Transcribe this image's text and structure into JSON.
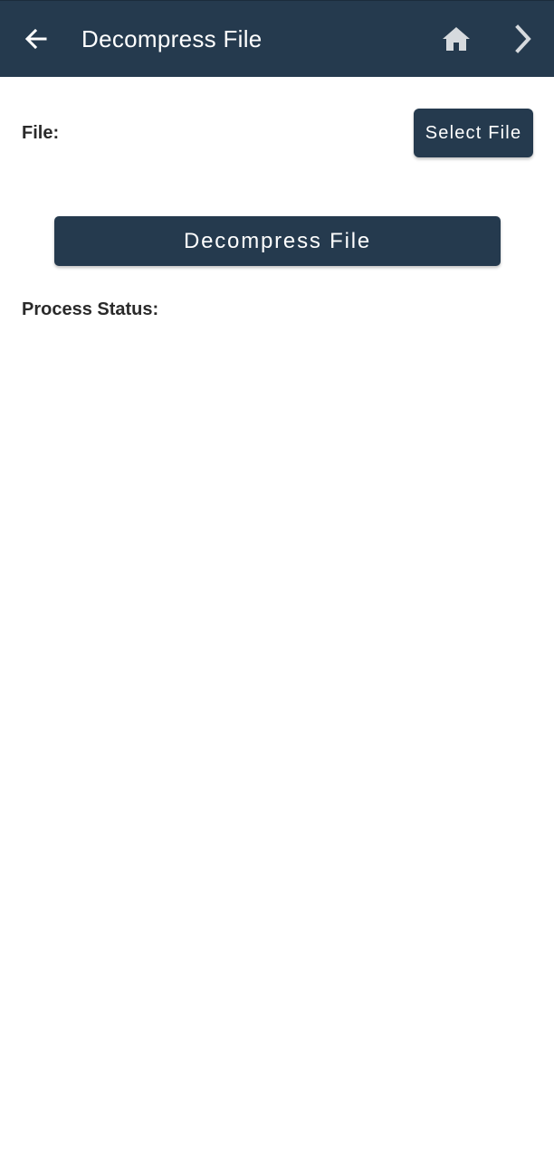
{
  "app_bar": {
    "title": "Decompress File",
    "back_icon": "arrow-back-icon",
    "home_icon": "home-icon",
    "next_icon": "chevron-right-icon",
    "background_color": "#253a4e"
  },
  "form": {
    "file_label": "File:",
    "select_file_label": "Select File",
    "decompress_label": "Decompress File",
    "status_label": "Process Status:"
  },
  "colors": {
    "primary": "#253a4e",
    "text_dark": "#2a2a2a",
    "icon_home": "#d6dade"
  }
}
